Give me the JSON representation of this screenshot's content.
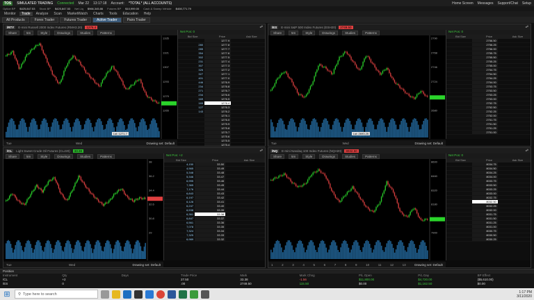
{
  "topbar": {
    "logo": "TOS",
    "mode": "SIMULATED TRADING",
    "status": "Connected",
    "zone": "Mar 22",
    "time": "13:17:18",
    "account_label": "Account:",
    "account": "*TOTAL* (ALL ACCOUNTS)",
    "right_items": [
      "Home Screen",
      "Messages",
      "Support/Chat",
      "Setup"
    ]
  },
  "acctbar": {
    "items": [
      [
        "Option BP",
        "$425,847.53"
      ],
      [
        "Stock BP",
        "$425,847.53"
      ],
      [
        "Net Liq",
        "$966,345.86"
      ],
      [
        "Futures BP",
        "$10,999.00"
      ],
      [
        "Cash & Sweep Vehicle",
        "$408,771.79"
      ]
    ]
  },
  "menu": {
    "items": [
      "Monitor",
      "Trade",
      "Analyze",
      "Scan",
      "MarketWatch",
      "Charts",
      "Tools",
      "Education",
      "Help"
    ],
    "active": 1
  },
  "subtabs": {
    "items": [
      "All Products",
      "Forex Trader",
      "Futures Trader",
      "Active Trader",
      "Pairs Trader"
    ],
    "active": 3
  },
  "panes": [
    {
      "sym": "/RTY",
      "desc": "E-mini Russell 2000 Index Futures (RMH3.20)",
      "price": "1276.4",
      "share": "Share",
      "tf": "5m",
      "style": "Style",
      "drawings": "Drawings",
      "studies": "Studies",
      "patterns": "Patterns",
      "netpos": "Net Pos: 0",
      "drawset": "Drawing set: Default",
      "cur_label": "Lst: 1271.7",
      "x_ticks": [
        "Tue",
        "Wed"
      ],
      "ladder": {
        "head": [
          "Bid Size",
          "Price",
          "Ask Size"
        ],
        "rows": [
          [
            "",
            "1277.9",
            ""
          ],
          [
            "280",
            "1277.8",
            ""
          ],
          [
            "285",
            "1277.7",
            ""
          ],
          [
            "354",
            "1277.6",
            ""
          ],
          [
            "302",
            "1277.5",
            ""
          ],
          [
            "231",
            "1277.4",
            ""
          ],
          [
            "307",
            "1277.3",
            ""
          ],
          [
            "326",
            "1277.2",
            ""
          ],
          [
            "327",
            "1277.1",
            ""
          ],
          [
            "401",
            "1277.0",
            ""
          ],
          [
            "446",
            "1276.9",
            ""
          ],
          [
            "234",
            "1276.8",
            ""
          ],
          [
            "271",
            "1276.7",
            ""
          ],
          [
            "234",
            "1276.6",
            ""
          ],
          [
            "169",
            "1276.5",
            ""
          ],
          [
            "165",
            "1276.4",
            ""
          ],
          [
            "127",
            "1276.3",
            ""
          ],
          [
            "143",
            "1276.2",
            ""
          ],
          [
            "",
            "1276.1",
            ""
          ],
          [
            "",
            "1276.0",
            ""
          ],
          [
            "",
            "1275.9",
            ""
          ],
          [
            "",
            "1275.8",
            ""
          ],
          [
            "",
            "1275.7",
            ""
          ],
          [
            "",
            "1275.6",
            ""
          ],
          [
            "",
            "1275.5",
            ""
          ],
          [
            "",
            "1275.4",
            ""
          ],
          [
            "",
            "1275.3",
            ""
          ]
        ]
      }
    },
    {
      "sym": "/ES",
      "desc": "E-mini S&P 500 Index Futures (ESH20)",
      "price": "2749.50",
      "share": "Share",
      "tf": "5m",
      "style": "Style",
      "drawings": "Drawings",
      "studies": "Studies",
      "patterns": "Patterns",
      "netpos": "Net Pos: 0",
      "drawset": "Drawing set: Default",
      "cur_label": "Lst: 2693.25",
      "x_ticks": [
        "Tue",
        "Wed"
      ],
      "ladder": {
        "head": [
          "Bid Size",
          "Price",
          "Ask Size"
        ],
        "rows": [
          [
            "",
            "2756.50",
            ""
          ],
          [
            "",
            "2756.25",
            ""
          ],
          [
            "",
            "2756.00",
            ""
          ],
          [
            "",
            "2755.75",
            ""
          ],
          [
            "",
            "2755.50",
            ""
          ],
          [
            "",
            "2755.25",
            ""
          ],
          [
            "",
            "2755.00",
            ""
          ],
          [
            "",
            "2754.75",
            ""
          ],
          [
            "",
            "2754.50",
            ""
          ],
          [
            "",
            "2754.25",
            ""
          ],
          [
            "",
            "2754.00",
            ""
          ],
          [
            "",
            "2753.75",
            ""
          ],
          [
            "",
            "2753.50",
            ""
          ],
          [
            "",
            "2753.25",
            ""
          ],
          [
            "",
            "2753.00",
            ""
          ],
          [
            "",
            "2752.75",
            ""
          ],
          [
            "",
            "2752.50",
            ""
          ],
          [
            "",
            "2752.25",
            ""
          ],
          [
            "",
            "2752.00",
            ""
          ],
          [
            "",
            "2751.75",
            ""
          ],
          [
            "",
            "2751.50",
            ""
          ],
          [
            "",
            "2751.25",
            ""
          ],
          [
            "",
            "2751.00",
            ""
          ]
        ]
      }
    },
    {
      "sym": "/CL",
      "desc": "Light Sweet Crude Oil Futures (CLJ20)",
      "price": "33.38",
      "share": "Share",
      "tf": "5m",
      "style": "Style",
      "drawings": "Drawings",
      "studies": "Studies",
      "patterns": "Patterns",
      "netpos": "Net Pos: +2",
      "drawset": "Drawing set: Default",
      "cur_label": "",
      "x_ticks": [
        "Tue",
        "Wed"
      ],
      "ladder": {
        "head": [
          "Bid Size",
          "Price",
          "Ask Size"
        ],
        "rows": [
          [
            "4,150",
            "33.50",
            ""
          ],
          [
            "4,565",
            "33.49",
            ""
          ],
          [
            "5,348",
            "33.48",
            ""
          ],
          [
            "5,346",
            "33.47",
            ""
          ],
          [
            "6,995",
            "33.46",
            ""
          ],
          [
            "7,365",
            "33.45",
            ""
          ],
          [
            "7,176",
            "33.44",
            ""
          ],
          [
            "6,843",
            "33.43",
            ""
          ],
          [
            "6,197",
            "33.42",
            ""
          ],
          [
            "6,128",
            "33.41",
            ""
          ],
          [
            "6,247",
            "33.40",
            ""
          ],
          [
            "6,538",
            "33.39",
            ""
          ],
          [
            "6,361",
            "33.38",
            ""
          ],
          [
            "6,847",
            "33.37",
            ""
          ],
          [
            "6,561",
            "33.36",
            ""
          ],
          [
            "7,078",
            "33.35",
            ""
          ],
          [
            "7,324",
            "33.34",
            ""
          ],
          [
            "7,325",
            "33.33",
            ""
          ],
          [
            "6,989",
            "33.32",
            ""
          ]
        ]
      }
    },
    {
      "sym": "/NQ",
      "desc": "E-mini Nasdaq 100 Index Futures (NQH20)",
      "price": "8032.50",
      "share": "Share",
      "tf": "5m",
      "style": "Style",
      "drawings": "Drawings",
      "studies": "Studies",
      "patterns": "Patterns",
      "netpos": "Net Pos: 0",
      "drawset": "Drawing set: Default",
      "cur_label": "",
      "x_ticks": [
        "1",
        "2",
        "3",
        "4",
        "5",
        "6",
        "7",
        "8",
        "9",
        "10",
        "11",
        "12",
        "13"
      ],
      "ladder": {
        "head": [
          "Bid Size",
          "Price",
          "Ask Size"
        ],
        "rows": [
          [
            "",
            "8034.75",
            ""
          ],
          [
            "",
            "8034.50",
            ""
          ],
          [
            "",
            "8034.25",
            ""
          ],
          [
            "",
            "8034.00",
            ""
          ],
          [
            "",
            "8033.75",
            ""
          ],
          [
            "",
            "8033.50",
            ""
          ],
          [
            "",
            "8033.25",
            ""
          ],
          [
            "",
            "8033.00",
            ""
          ],
          [
            "",
            "8032.75",
            ""
          ],
          [
            "",
            "8032.50",
            ""
          ],
          [
            "",
            "8032.25",
            ""
          ],
          [
            "",
            "8032.00",
            ""
          ],
          [
            "",
            "8031.75",
            ""
          ],
          [
            "",
            "8031.50",
            ""
          ],
          [
            "",
            "8031.25",
            ""
          ],
          [
            "",
            "8031.00",
            ""
          ],
          [
            "",
            "8030.75",
            ""
          ],
          [
            "",
            "8030.50",
            ""
          ],
          [
            "",
            "8030.25",
            ""
          ]
        ]
      }
    }
  ],
  "positions": {
    "title": "Position",
    "head": [
      "Instrument",
      "Qty",
      "Days",
      "Trade Price",
      "Mark",
      "Mark Chng",
      "P/L Open",
      "P/L Day",
      "BP Effect"
    ],
    "rows": [
      [
        "/CL",
        "+2",
        "",
        "27.50",
        "33.38",
        "-1.56",
        "$11,800.00",
        "$4,720.00",
        "($5,610.00)"
      ],
      [
        "/ES",
        "0",
        "",
        ".00",
        "2749.50",
        "115.50",
        "$0.00",
        "$1,162.50",
        "$0.00"
      ]
    ]
  },
  "taskbar": {
    "search": "Type here to search",
    "time": "1:17 PM",
    "date": "3/11/2020"
  }
}
